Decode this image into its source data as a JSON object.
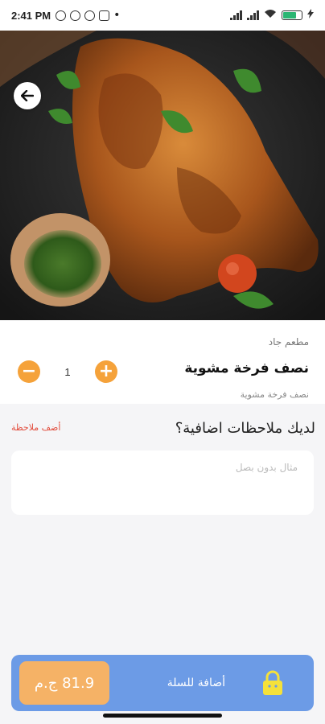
{
  "status_bar": {
    "time": "2:41 PM",
    "icons": [
      "alarm-icon",
      "whatsapp-icon",
      "app-icon",
      "news-icon"
    ],
    "battery_percent": 68
  },
  "hero": {
    "image": "grilled-half-chicken-photo",
    "back_icon": "arrow-left-icon"
  },
  "product": {
    "restaurant": "مطعم جاد",
    "title": "نصف فرخة مشوية",
    "subtitle": "نصف فرخة مشوية",
    "quantity": "1",
    "minus_icon": "minus-icon",
    "plus_icon": "plus-icon"
  },
  "notes": {
    "title": "لديك ملاحظات اضافية؟",
    "add_label": "أضف ملاحظة",
    "placeholder": "مثال بدون بصل",
    "value": ""
  },
  "cart": {
    "price": "81.9 ج.م",
    "label": "أضافة للسلة",
    "icon": "lock-icon"
  },
  "colors": {
    "accent": "#f5a23a",
    "cart_bar": "#6c9be6",
    "price_box": "#f5b266",
    "add_note": "#e24b3b"
  }
}
